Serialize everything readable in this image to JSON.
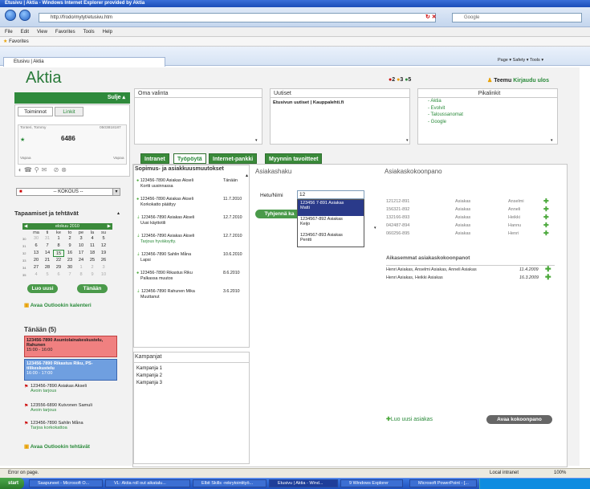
{
  "browser": {
    "title": "Etusivu | Aktia - Windows Internet Explorer provided by Aktia",
    "address": "http://frodo/mytyt/etusivu.htm",
    "search_placeholder": "Google",
    "menu": [
      "File",
      "Edit",
      "View",
      "Favorites",
      "Tools",
      "Help"
    ],
    "favorites": "Favorites",
    "tab": "Etusivu | Aktia",
    "toolbar_right": "Page ▾  Safety ▾  Tools ▾",
    "status": "Error on page.",
    "zone": "Local intranet",
    "zoom": "100%"
  },
  "app": {
    "logo": "Aktia",
    "counters": {
      "a": "2",
      "b": "3",
      "c": "5"
    },
    "user": "Teemu",
    "logout": "Kirjaudu ulos"
  },
  "left": {
    "close": "Sulje ▴",
    "tabs": [
      "Toiminnot",
      "Linkit"
    ],
    "user_name": "Tonteri, Tommy",
    "user_phone": "0503818187",
    "user_num": "6486",
    "vapaa1": "Vapaa",
    "vapaa2": "Vapaa",
    "kokous": "-- KOKOUS --",
    "tasks_header": "Tapaamiset ja tehtävät",
    "calendar": {
      "month": "elokuu 2010",
      "days": [
        "ma",
        "ti",
        "ke",
        "to",
        "pe",
        "la",
        "su"
      ],
      "weeks": [
        {
          "w": "30",
          "d": [
            "30",
            "31",
            "1",
            "2",
            "3",
            "4",
            "5"
          ]
        },
        {
          "w": "31",
          "d": [
            "6",
            "7",
            "8",
            "9",
            "10",
            "11",
            "12"
          ]
        },
        {
          "w": "32",
          "d": [
            "13",
            "14",
            "15",
            "16",
            "17",
            "18",
            "19"
          ]
        },
        {
          "w": "33",
          "d": [
            "20",
            "21",
            "22",
            "23",
            "24",
            "25",
            "26"
          ]
        },
        {
          "w": "34",
          "d": [
            "27",
            "28",
            "29",
            "30",
            "1",
            "2",
            "3"
          ]
        },
        {
          "w": "35",
          "d": [
            "4",
            "5",
            "6",
            "7",
            "8",
            "9",
            "10"
          ]
        }
      ]
    },
    "luo_uusi": "Luo uusi",
    "tanaan": "Tänään",
    "outlook_cal": "Avaa Outlookin kalenteri",
    "today_header": "Tänään (5)",
    "events": [
      {
        "title": "123456-7890 Asuntolainakeskustelu, Rahunen",
        "time": "15:00 - 16:00"
      },
      {
        "title": "123456-7890 Rikastus Riku, PS-tilikeskustelu",
        "time": "16:00 - 17:00"
      }
    ],
    "tasks": [
      {
        "title": "123456-7890 Asiakas Akseli",
        "sub": "Avoin tarjous"
      },
      {
        "title": "123556-6890 Kutvonen Samuli",
        "sub": "Avoin tarjous"
      },
      {
        "title": "123456-7890 Sahlin Måna",
        "sub": "Tarjoa korkokattoa"
      }
    ],
    "outlook_tasks": "Avaa Outlookin tehtävät"
  },
  "top_panels": {
    "oma": "Oma valinta",
    "uutiset": "Uutiset",
    "uutiset_text": "Etusivun uutiset | Kauppalehti.fi",
    "pika": "Pikalinkit",
    "pika_links": [
      "- Aktia",
      "- Evolvit",
      "- Taloussanomat",
      "- Google"
    ]
  },
  "tabs": [
    "Intranet",
    "Työpöytä",
    "Internet-pankki",
    "Myynnin tavoitteet"
  ],
  "changes": {
    "header": "Sopimus- ja asiakkuusmuutokset",
    "items": [
      {
        "name": "123456-7890 Asiakas Akseli",
        "date": "Tänään",
        "sub": "Kortti uusinnassa"
      },
      {
        "name": "123456-7890 Asiakas Akseli",
        "date": "11.7.2010",
        "sub": "Korkokatto päättyy"
      },
      {
        "name": "123456-7890 Asiakas Akseli",
        "date": "12.7.2010",
        "sub": "Uusi käyttotili"
      },
      {
        "name": "123456-7890 Asiakas Akseli",
        "date": "12.7.2010",
        "sub": "Tarjous hyväksytty."
      },
      {
        "name": "123456-7890 Sahlin Måna",
        "date": "10.6.2010",
        "sub": "Lapsi"
      },
      {
        "name": "123456-7890 Rikastus Riku",
        "date": "8.6.2010",
        "sub": "Palkassa muutos"
      },
      {
        "name": "123456-7890 Rahunen Mika",
        "date": "3.6.2010",
        "sub": "Muuttanut"
      }
    ]
  },
  "kampanjat": {
    "header": "Kampanjat",
    "items": [
      "Kampanja 1",
      "Kampanja 2",
      "Kampanja 3"
    ]
  },
  "asiakashaku": {
    "header": "Asiakashaku",
    "label": "Hetu/Nimi",
    "value": "12",
    "button": "Tyhjennä ka",
    "suggestions": [
      {
        "id": "123456 7-891 Asiakas",
        "name": "Matti"
      },
      {
        "id": "1234567-892 Asiakas",
        "name": "Keijo"
      },
      {
        "id": "1234567-893 Asiakas",
        "name": "Pentti"
      }
    ]
  },
  "kokoonpano": {
    "header": "Asiakaskokoonpano",
    "rows": [
      {
        "id": "121212-891",
        "a": "Asiakas",
        "b": "Anselmi"
      },
      {
        "id": "156321-892",
        "a": "Asiakas",
        "b": "Anneli"
      },
      {
        "id": "132166-893",
        "a": "Asiakas",
        "b": "Heikki"
      },
      {
        "id": "042487-894",
        "a": "Asiakas",
        "b": "Hannu"
      },
      {
        "id": "060256-895",
        "a": "Asiakas",
        "b": "Henri"
      }
    ],
    "prev_header": "Aikasemmat asiakaskokoonpanot",
    "prev": [
      {
        "text": "Henri Asiakas, Anselmi Asiakas, Anneli Asiakas",
        "date": "11.4.2009"
      },
      {
        "text": "Henri Asiakas, Heikki Asiakas",
        "date": "16.3.2009"
      }
    ],
    "new_customer": "Luo uusi asiakas",
    "open_button": "Avaa kokoonpano"
  },
  "taskbar": [
    "Saapuneet - Microsoft O...",
    "VL: Aktia roll out aikatalu...",
    "Elbit Skills -rekrytointityö...",
    "Etusivu | Aktia - Wind...",
    "9 Windows Explorer",
    "Microsoft PowerPoint - [..."
  ],
  "start": "start"
}
